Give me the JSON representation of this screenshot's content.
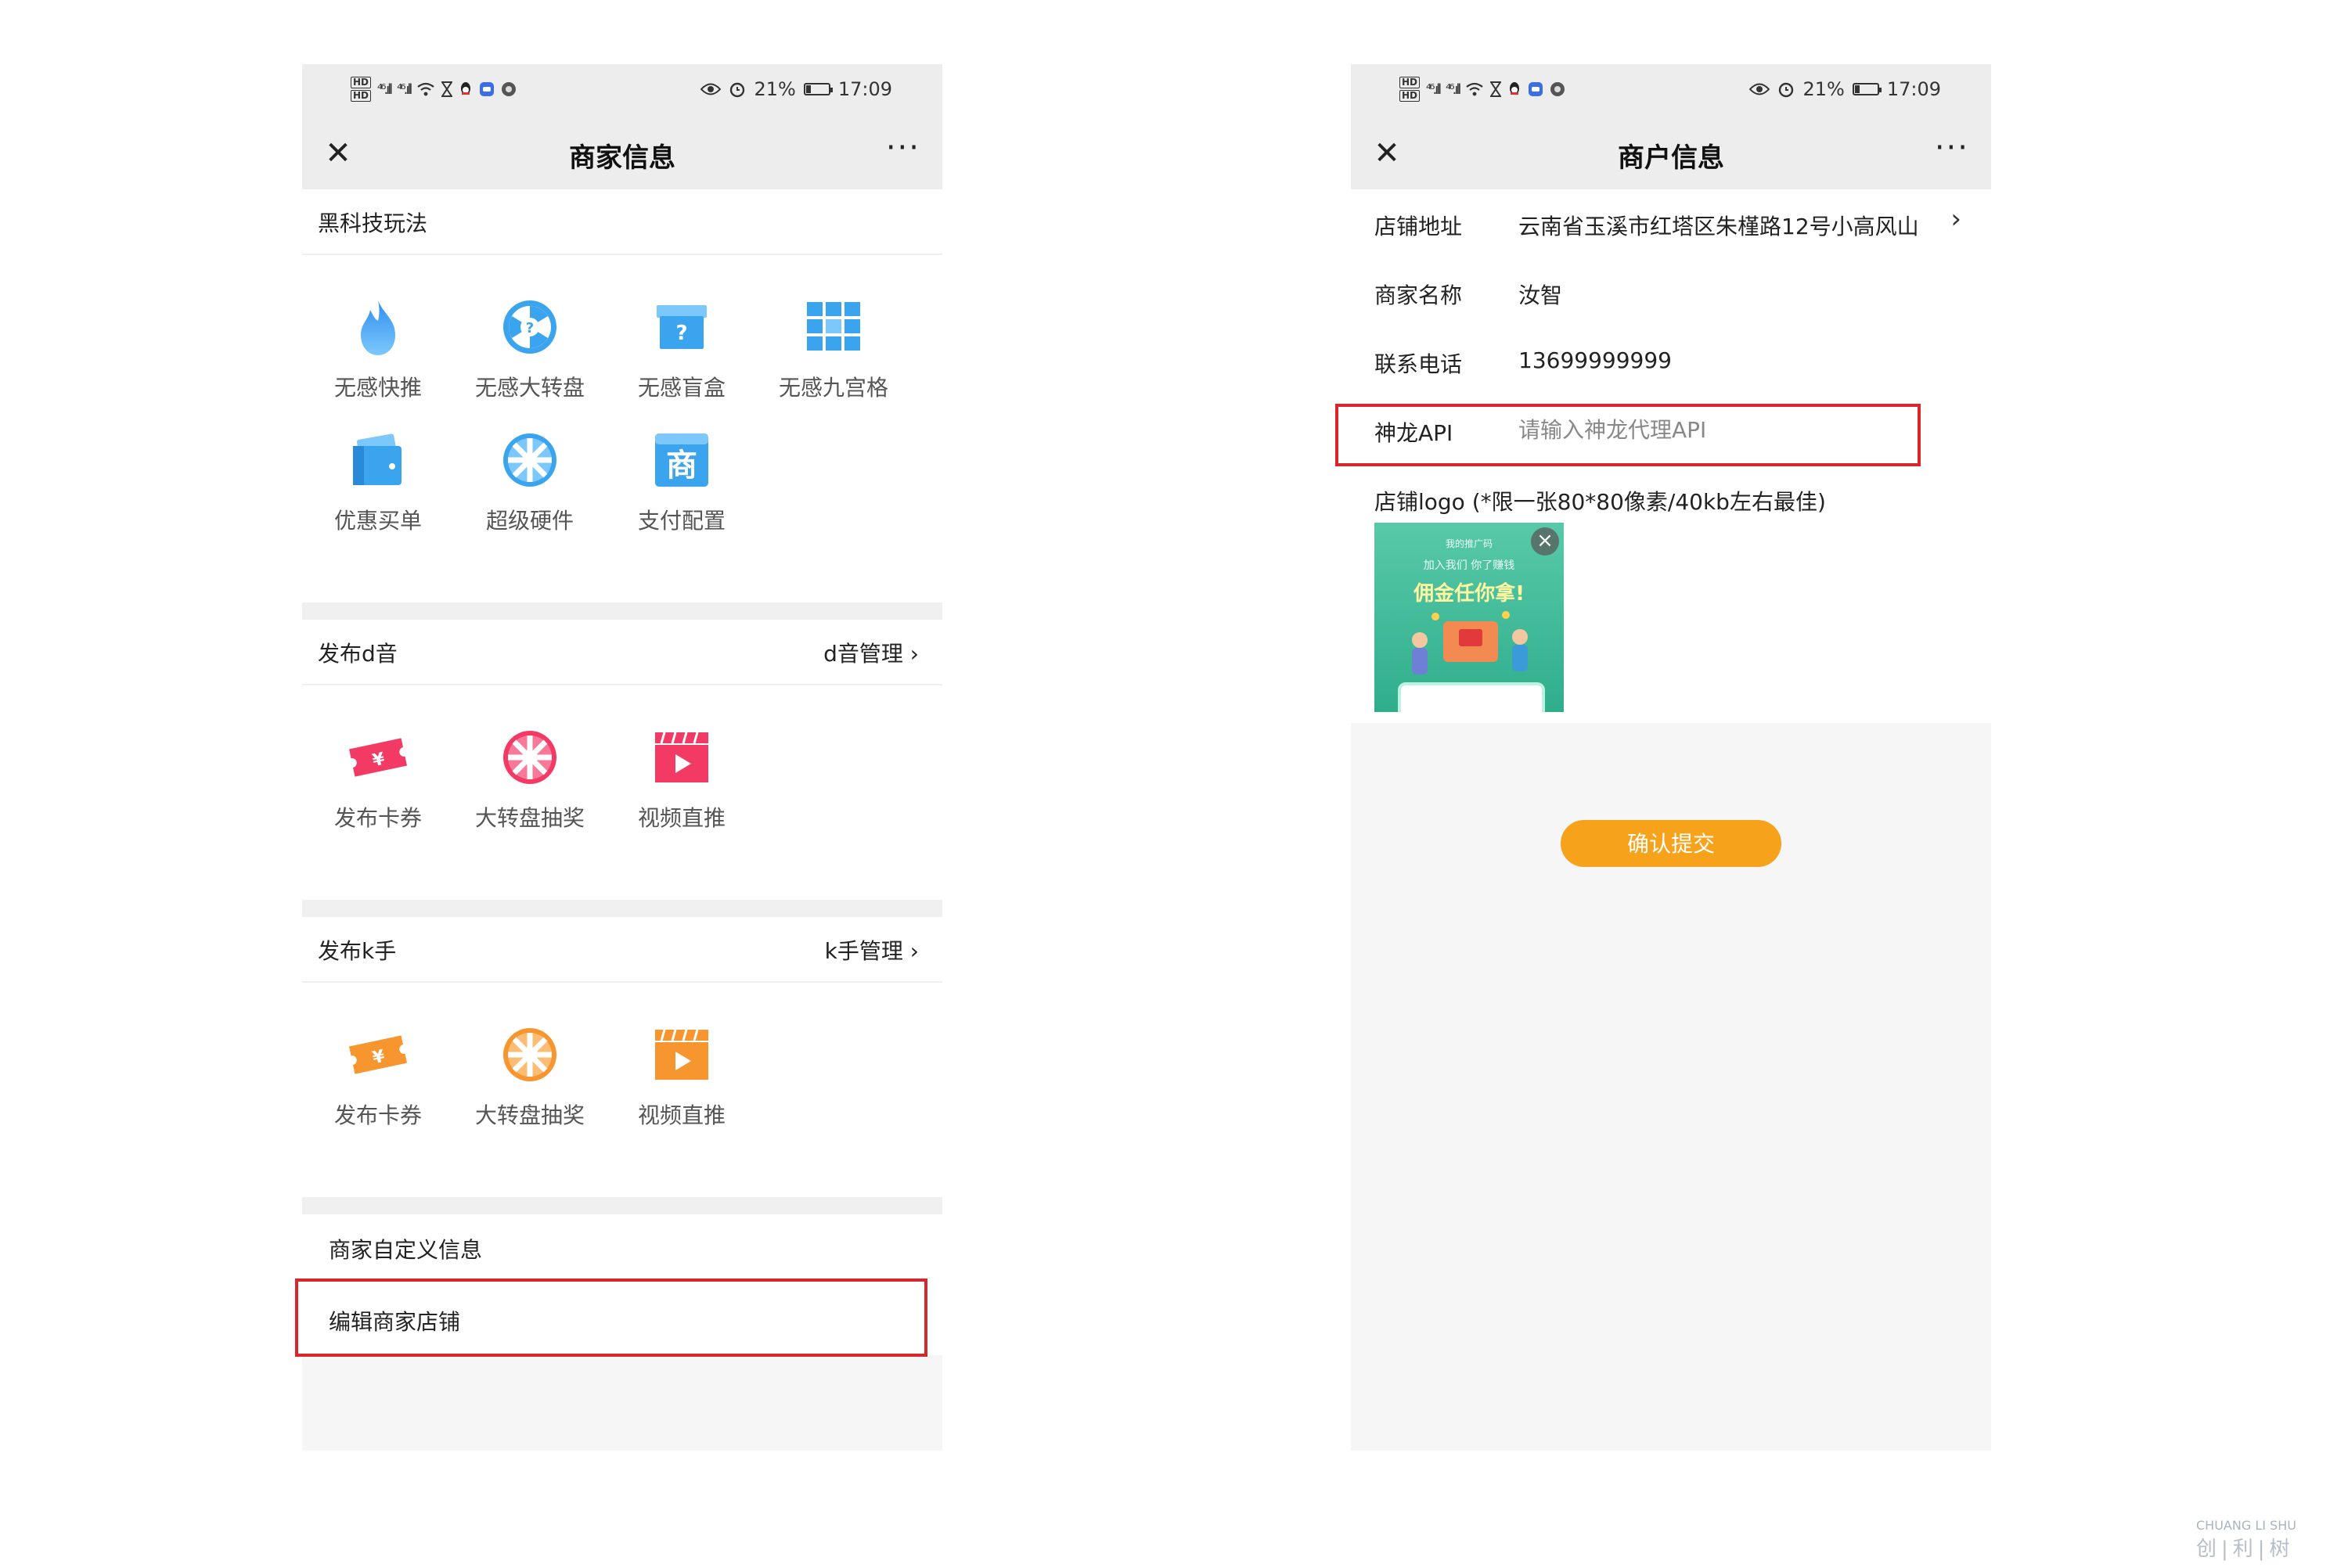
{
  "left_screen": {
    "status": {
      "hd1": "HD",
      "hd2": "HD",
      "sig1": "⁴⁶.ıll",
      "sig2": "⁴⁶.ıll",
      "battery": "21%",
      "battery_level": 0.21,
      "time": "17:09"
    },
    "nav": {
      "close": "✕",
      "title": "商家信息",
      "more": "···"
    },
    "black_tech": {
      "title": "黑科技玩法",
      "items": [
        {
          "label": "无感快推",
          "icon": "flame-icon"
        },
        {
          "label": "无感大转盘",
          "icon": "wheel-question-icon"
        },
        {
          "label": "无感盲盒",
          "icon": "blind-box-icon"
        },
        {
          "label": "无感九宫格",
          "icon": "grid-icon"
        },
        {
          "label": "优惠买单",
          "icon": "wallet-icon"
        },
        {
          "label": "超级硬件",
          "icon": "wheel-icon"
        },
        {
          "label": "支付配置",
          "icon": "shop-icon"
        }
      ],
      "shop_glyph": "商"
    },
    "douyin": {
      "title": "发布d音",
      "link": "d音管理 ›",
      "items": [
        {
          "label": "发布卡券",
          "icon": "coupon-icon"
        },
        {
          "label": "大转盘抽奖",
          "icon": "wheel-icon"
        },
        {
          "label": "视频直推",
          "icon": "video-icon"
        }
      ],
      "color": "#f23a64"
    },
    "kuaishou": {
      "title": "发布k手",
      "link": "k手管理 ›",
      "items": [
        {
          "label": "发布卡券",
          "icon": "coupon-icon"
        },
        {
          "label": "大转盘抽奖",
          "icon": "wheel-icon"
        },
        {
          "label": "视频直推",
          "icon": "video-icon"
        }
      ],
      "color": "#f7952f"
    },
    "custom_info": "商家自定义信息",
    "edit_shop": "编辑商家店铺"
  },
  "right_screen": {
    "status": {
      "hd1": "HD",
      "hd2": "HD",
      "sig1": "⁴⁶.ıll",
      "sig2": "⁴⁶.ıll",
      "battery": "21%",
      "battery_level": 0.21,
      "time": "17:09"
    },
    "nav": {
      "close": "✕",
      "title": "商户信息",
      "more": "···"
    },
    "fields": {
      "address_label": "店铺地址",
      "address_value": "云南省玉溪市红塔区朱槿路12号小高风山",
      "chevron": "›",
      "name_label": "商家名称",
      "name_value": "汝智",
      "phone_label": "联系电话",
      "phone_value": "13699999999",
      "api_label": "神龙API",
      "api_placeholder": "请输入神龙代理API"
    },
    "logo_label": "店铺logo (*限一张80*80像素/40kb左右最佳)",
    "logo_image": {
      "small_text": "我的推广码",
      "line2": "加入我们 你了赚钱",
      "headline": "佣金任你拿!",
      "remove": "×"
    },
    "submit": "确认提交"
  },
  "watermark": {
    "line1": "CHUANG LI SHU",
    "line2": "创|利|树"
  },
  "colors": {
    "highlight_red": "#d9262c",
    "accent_orange": "#f7a21b",
    "blue": "#3ba4ee"
  }
}
